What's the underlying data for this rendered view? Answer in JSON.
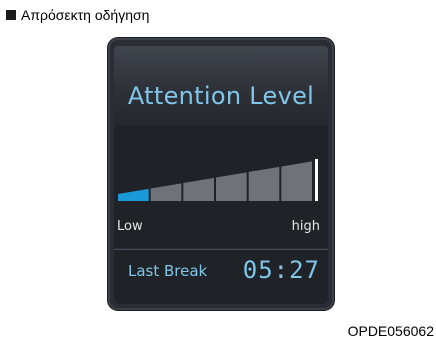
{
  "heading": {
    "text": "Απρόσεκτη οδήγηση"
  },
  "display": {
    "title": "Attention Level",
    "meter": {
      "segments": 6,
      "active_segments": 1,
      "low_label": "Low",
      "high_label": "high",
      "colors": {
        "active": "#1a9ad8",
        "inactive": "#6f7276",
        "marker": "#ffffff"
      }
    },
    "last_break": {
      "label": "Last Break",
      "time": "05:27"
    },
    "accent_color": "#7fc6ea"
  },
  "figure_code": "OPDE056062"
}
